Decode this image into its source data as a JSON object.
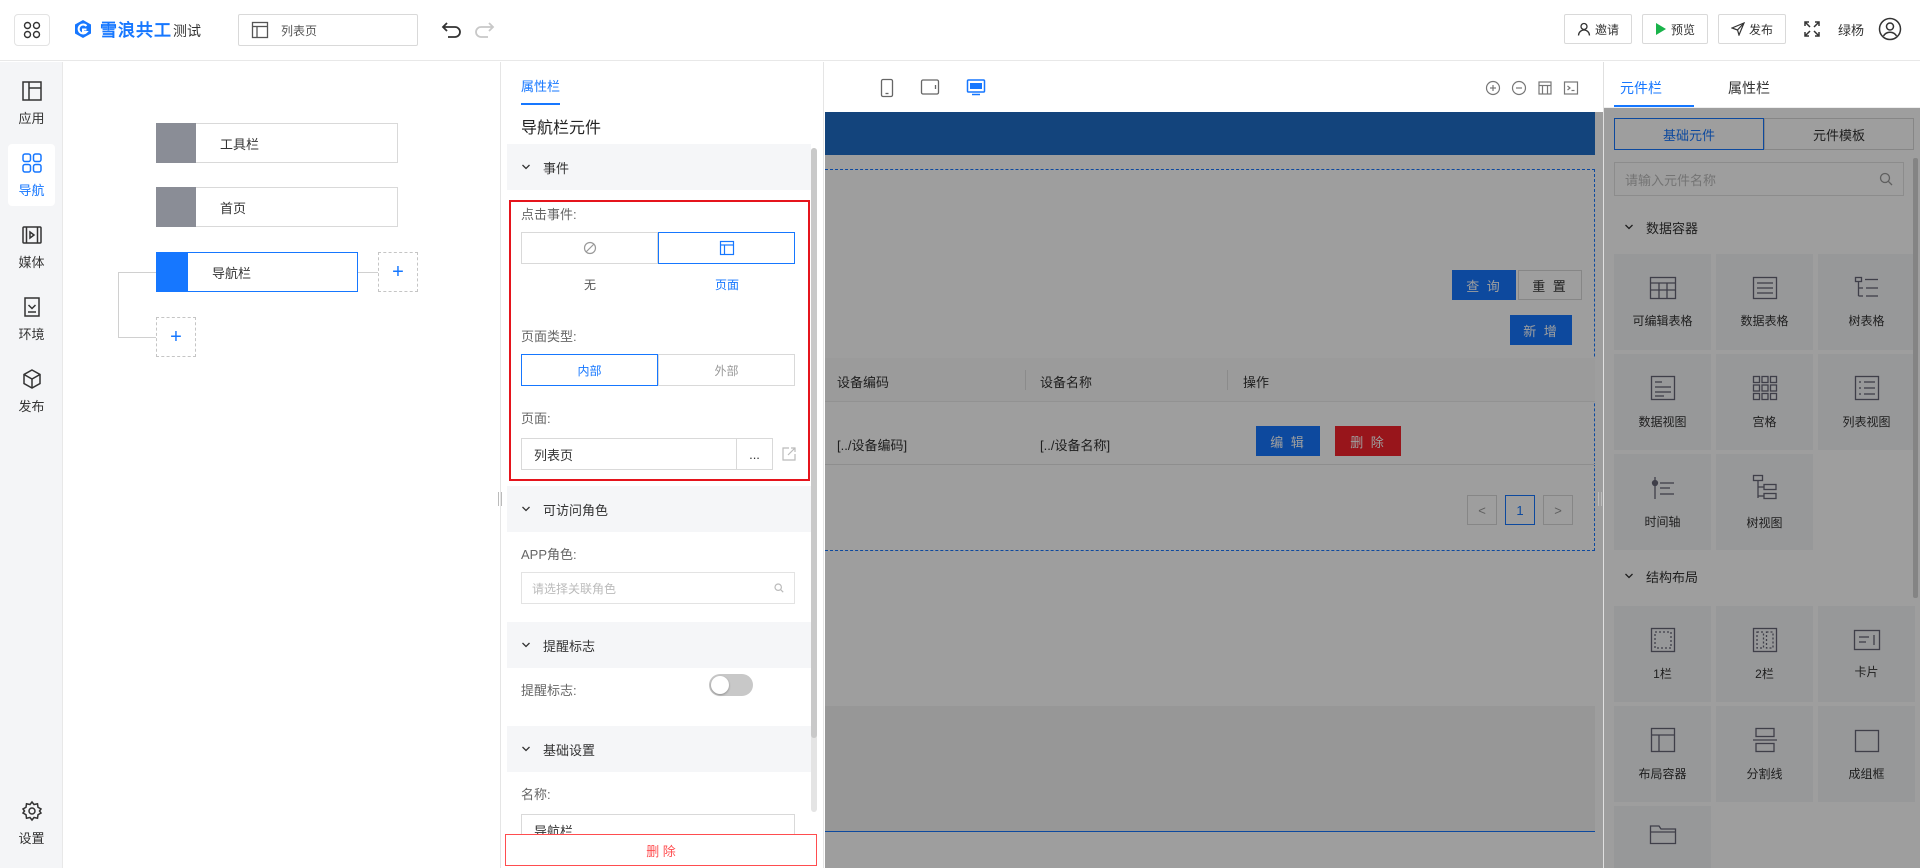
{
  "topbar": {
    "brand": "雪浪共工",
    "project": "测试",
    "page": "列表页",
    "invite": "邀请",
    "preview": "预览",
    "publish": "发布",
    "user": "绿杨"
  },
  "leftnav": [
    {
      "label": "应用",
      "icon": "app-layout-icon"
    },
    {
      "label": "导航",
      "icon": "grid-icon",
      "active": true
    },
    {
      "label": "媒体",
      "icon": "media-icon"
    },
    {
      "label": "环境",
      "icon": "environment-icon"
    },
    {
      "label": "发布",
      "icon": "cube-icon"
    },
    {
      "label": "设置",
      "icon": "gear-icon"
    }
  ],
  "tree": {
    "nodes": [
      "工具栏",
      "首页",
      "导航栏"
    ],
    "add": "+"
  },
  "property": {
    "tab": "属性栏",
    "title": "导航栏元件",
    "event_section": "事件",
    "click_event_label": "点击事件:",
    "click_none": "无",
    "click_page": "页面",
    "page_type_label": "页面类型:",
    "page_type_internal": "内部",
    "page_type_external": "外部",
    "page_label": "页面:",
    "page_value": "列表页",
    "page_more": "...",
    "roles_section": "可访问角色",
    "app_role_label": "APP角色:",
    "app_role_placeholder": "请选择关联角色",
    "remind_section": "提醒标志",
    "remind_label": "提醒标志:",
    "remind_on": false,
    "basic_section": "基础设置",
    "name_label": "名称:",
    "name_value": "导航栏",
    "delete": "删 除"
  },
  "canvas": {
    "query": "查 询",
    "reset": "重 置",
    "add": "新 增",
    "columns": [
      "设备编码",
      "设备名称",
      "操作"
    ],
    "row": [
      "[../设备编码]",
      "[../设备名称]"
    ],
    "edit": "编 辑",
    "delete": "删 除",
    "page_prev": "<",
    "page_current": "1",
    "page_next": ">"
  },
  "rpanel": {
    "tab_components": "元件栏",
    "tab_properties": "属性栏",
    "seg_basic": "基础元件",
    "seg_template": "元件模板",
    "search_placeholder": "请输入元件名称",
    "group_data": "数据容器",
    "data_tiles": [
      "可编辑表格",
      "数据表格",
      "树表格",
      "数据视图",
      "宫格",
      "列表视图",
      "时间轴",
      "树视图"
    ],
    "group_layout": "结构布局",
    "layout_tiles": [
      "1栏",
      "2栏",
      "卡片",
      "布局容器",
      "分割线",
      "成组框"
    ]
  },
  "colors": {
    "accent": "#1677ff",
    "highlight_frame": "#e5141c",
    "danger": "#ff4d4f"
  }
}
